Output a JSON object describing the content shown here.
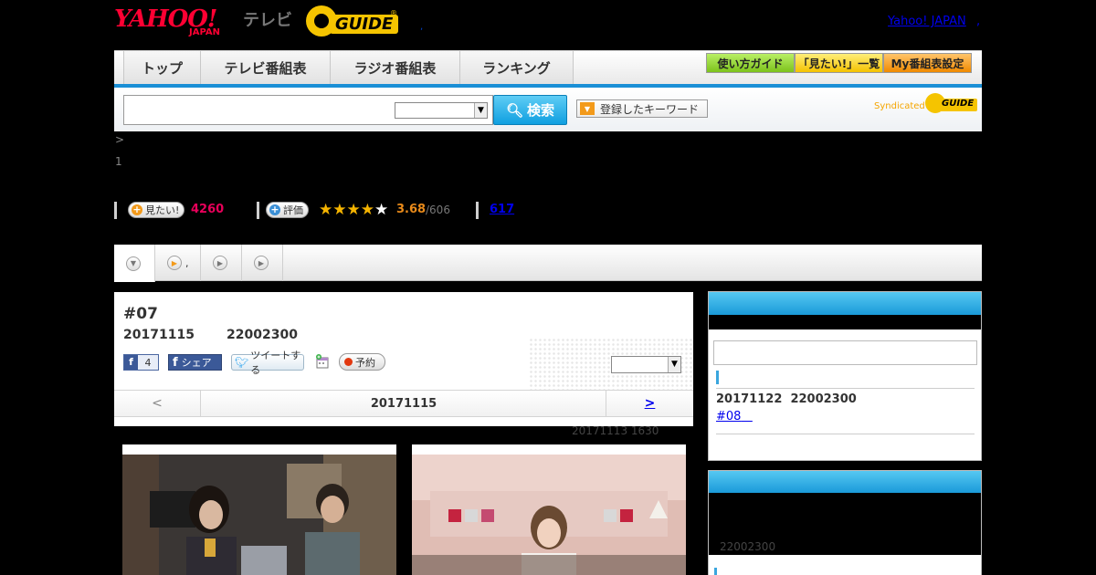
{
  "header": {
    "yahoo_logo": "YAHOO!",
    "yahoo_logo_sub": "JAPAN",
    "tv_label": "テレビ",
    "gguide_logo": "GUIDE",
    "gguide_reg": "®",
    "dot": ",",
    "yahoo_japan_link": "Yahoo! JAPAN",
    "yahoo_japan_dot": ","
  },
  "nav": {
    "tabs": [
      {
        "label": "トップ"
      },
      {
        "label": "テレビ番組表"
      },
      {
        "label": "ラジオ番組表"
      },
      {
        "label": "ランキング"
      }
    ],
    "utils": [
      {
        "label": "使い方ガイド"
      },
      {
        "label": "「見たい!」一覧"
      },
      {
        "label": "My番組表設定"
      }
    ]
  },
  "search": {
    "input_value": "",
    "select_value": "",
    "button_label": "検索",
    "keyword_button": "登録したキーワード",
    "syndicated_label": "Syndicated",
    "syndicated_logo": "GUIDE"
  },
  "breadcrumb": {
    "arrow": ">",
    "index": "1"
  },
  "counters": {
    "want_label": "見たい!",
    "want_count": "4260",
    "rate_label": "評価",
    "stars_full": 3,
    "stars_partial": 1,
    "stars_total": 5,
    "rating": "3.68",
    "rating_total": "/606",
    "review_count": "617"
  },
  "subtabs": [
    {
      "label": "",
      "icon": "chevron-down-icon"
    },
    {
      "label": ",",
      "icon": "play-icon"
    },
    {
      "label": "",
      "icon": "play-icon"
    },
    {
      "label": "",
      "icon": "play-icon"
    }
  ],
  "episode": {
    "title": "#07",
    "date": "20171115",
    "time": "22002300",
    "like_count": "4",
    "share_label": "シェア",
    "tweet_label": "ツイートする",
    "reserve_label": "予約",
    "select_value": ""
  },
  "pager": {
    "prev": "<",
    "current": "20171115",
    "next": ">"
  },
  "update_time": "20171113  1630",
  "sidebar": {
    "next_date": "20171122",
    "next_time": "22002300",
    "next_episode_link": "#08",
    "box2_time": "22002300"
  },
  "colors": {
    "accent_blue": "#1a8fd6",
    "want_pink": "#e8005a",
    "rating_orange": "#e88a1a",
    "star_gold": "#f5b400"
  }
}
